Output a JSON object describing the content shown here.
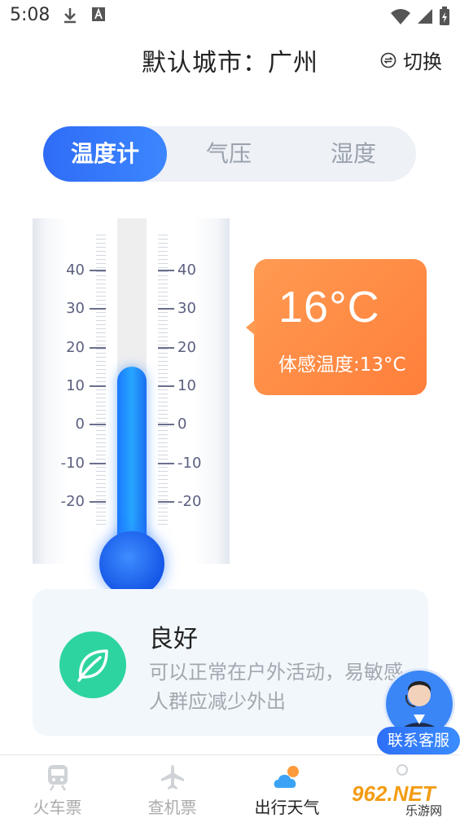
{
  "status_bar": {
    "time": "5:08",
    "icons": [
      "download-icon",
      "a-badge-icon",
      "wifi-icon",
      "signal-icon",
      "battery-icon"
    ]
  },
  "header": {
    "title": "默认城市：广州",
    "switch_label": "切换"
  },
  "tabs": [
    {
      "label": "温度计",
      "active": true
    },
    {
      "label": "气压",
      "active": false
    },
    {
      "label": "湿度",
      "active": false
    }
  ],
  "thermometer": {
    "scale": [
      "40",
      "30",
      "20",
      "10",
      "0",
      "-10",
      "-20"
    ],
    "mercury_value": 15,
    "mercury_color": "#1f8bff"
  },
  "reading": {
    "temperature": "16°C",
    "feels_like": "体感温度:13°C",
    "bubble_color": "#ff8c45"
  },
  "status_card": {
    "title": "良好",
    "description": "可以正常在户外活动，易敏感人群应减少外出",
    "icon": "leaf-icon",
    "icon_color": "#2ed4a0"
  },
  "customer_service": {
    "label": "联系客服"
  },
  "bottom_nav": [
    {
      "label": "火车票",
      "icon": "train-icon",
      "active": false
    },
    {
      "label": "查机票",
      "icon": "plane-icon",
      "active": false
    },
    {
      "label": "出行天气",
      "icon": "weather-icon",
      "active": true
    },
    {
      "label": "",
      "icon": "profile-icon",
      "active": false
    }
  ],
  "watermark": {
    "brand": "962.NET",
    "subtitle": "乐游网"
  },
  "colors": {
    "accent_blue": "#2f6cf6",
    "orange": "#ff8c45",
    "green": "#2ed4a0"
  }
}
